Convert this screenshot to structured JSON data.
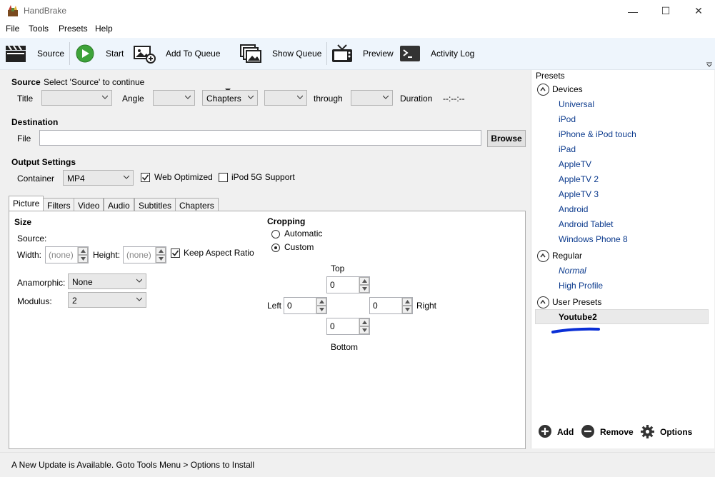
{
  "window": {
    "title": "HandBrake",
    "controls": {
      "minimize": "—",
      "maximize": "☐",
      "close": "✕"
    }
  },
  "menu": {
    "items": [
      "File",
      "Tools",
      "Presets",
      "Help"
    ]
  },
  "toolbar": {
    "source": "Source",
    "start": "Start",
    "add_to_queue": "Add To Queue",
    "show_queue": "Show Queue",
    "preview": "Preview",
    "activity_log": "Activity Log"
  },
  "source": {
    "label": "Source",
    "hint": "Select 'Source' to continue",
    "title_label": "Title",
    "angle_label": "Angle",
    "range_type": "Chapters",
    "through_label": "through",
    "duration_label": "Duration",
    "duration_value": "--:--:--"
  },
  "destination": {
    "label": "Destination",
    "file_label": "File",
    "file_value": "",
    "browse": "Browse"
  },
  "output": {
    "label": "Output Settings",
    "container_label": "Container",
    "container_value": "MP4",
    "web_optimized": "Web Optimized",
    "web_optimized_checked": true,
    "ipod_support": "iPod 5G Support",
    "ipod_checked": false
  },
  "tabs": [
    "Picture",
    "Filters",
    "Video",
    "Audio",
    "Subtitles",
    "Chapters"
  ],
  "picture": {
    "size_label": "Size",
    "source_label": "Source:",
    "width_label": "Width:",
    "height_label": "Height:",
    "width_placeholder": "(none)",
    "height_placeholder": "(none)",
    "keep_aspect": "Keep Aspect Ratio",
    "keep_aspect_checked": true,
    "anamorphic_label": "Anamorphic:",
    "anamorphic_value": "None",
    "modulus_label": "Modulus:",
    "modulus_value": "2"
  },
  "cropping": {
    "label": "Cropping",
    "automatic": "Automatic",
    "custom": "Custom",
    "selected": "Custom",
    "top_label": "Top",
    "bottom_label": "Bottom",
    "left_label": "Left",
    "right_label": "Right",
    "top": "0",
    "bottom": "0",
    "left": "0",
    "right": "0"
  },
  "presets": {
    "header": "Presets",
    "groups": [
      {
        "name": "Devices",
        "items": [
          "Universal",
          "iPod",
          "iPhone & iPod touch",
          "iPad",
          "AppleTV",
          "AppleTV 2",
          "AppleTV 3",
          "Android",
          "Android Tablet",
          "Windows Phone 8"
        ]
      },
      {
        "name": "Regular",
        "items": [
          "Normal",
          "High Profile"
        ]
      },
      {
        "name": "User Presets",
        "items": [
          "Youtube2"
        ]
      }
    ],
    "selected": "Youtube2",
    "add": "Add",
    "remove": "Remove",
    "options": "Options"
  },
  "status": {
    "message": "A New Update is Available. Goto Tools Menu > Options to Install"
  },
  "colors": {
    "link": "#0b3a8d",
    "annotation": "#0a2fd6",
    "toolbar_bg": "#eef5fc",
    "start_green": "#3ea33a"
  }
}
